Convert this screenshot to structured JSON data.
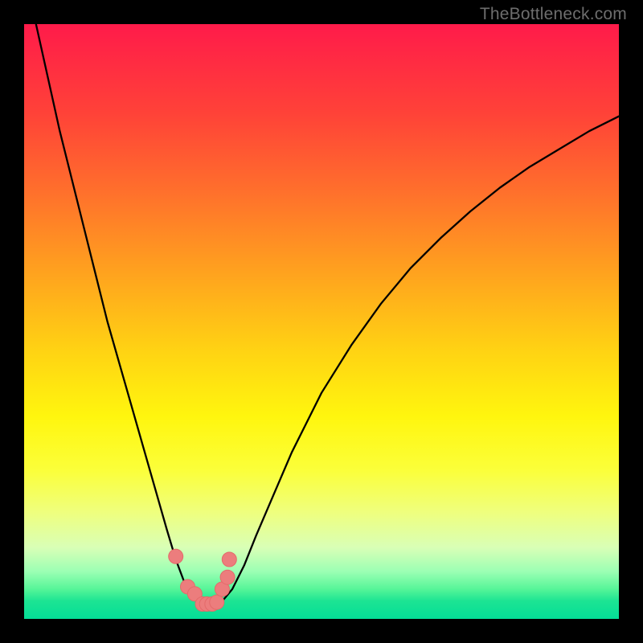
{
  "watermark": "TheBottleneck.com",
  "colors": {
    "background": "#000000",
    "curve": "#000000",
    "marker_fill": "#ec7d7d",
    "marker_stroke": "#e46a6a"
  },
  "chart_data": {
    "type": "line",
    "title": "",
    "xlabel": "",
    "ylabel": "",
    "xlim": [
      0,
      100
    ],
    "ylim": [
      0,
      100
    ],
    "grid": false,
    "legend": false,
    "series": [
      {
        "name": "bottleneck-curve",
        "x": [
          0,
          2,
          4,
          6,
          8,
          10,
          12,
          14,
          16,
          18,
          20,
          22,
          24,
          25.5,
          27,
          28.5,
          30,
          31,
          32,
          33.5,
          35,
          37,
          39,
          42,
          45,
          50,
          55,
          60,
          65,
          70,
          75,
          80,
          85,
          90,
          95,
          100
        ],
        "y": [
          108,
          100,
          91,
          82,
          74,
          66,
          58,
          50,
          43,
          36,
          29,
          22,
          15,
          10,
          6,
          3.5,
          2.2,
          2.2,
          2.4,
          3.2,
          5,
          9,
          14,
          21,
          28,
          38,
          46,
          53,
          59,
          64,
          68.5,
          72.5,
          76,
          79,
          82,
          84.5
        ]
      }
    ],
    "markers": {
      "name": "highlight-points",
      "x": [
        25.5,
        27.5,
        28.7,
        30,
        30.7,
        31.6,
        32.4,
        33.3,
        34.2,
        34.5
      ],
      "y": [
        10.5,
        5.4,
        4.2,
        2.5,
        2.5,
        2.5,
        2.8,
        5,
        7,
        10
      ]
    }
  }
}
